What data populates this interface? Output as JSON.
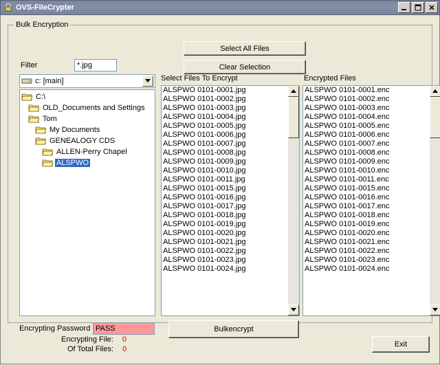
{
  "window": {
    "title": "OVS-FileCrypter"
  },
  "group_title": "Bulk Encryption",
  "buttons": {
    "select_all": "Select All Files",
    "clear_selection": "Clear Selection",
    "bulk_encrypt": "Bulkencrypt",
    "exit": "Exit"
  },
  "filter": {
    "label": "Filter",
    "value": "*.jpg"
  },
  "drive": {
    "text": "c: [main]"
  },
  "tree": [
    {
      "indent": 0,
      "label": "C:\\"
    },
    {
      "indent": 1,
      "label": "OLD_Documents and Settings"
    },
    {
      "indent": 1,
      "label": "Tom"
    },
    {
      "indent": 2,
      "label": "My Documents"
    },
    {
      "indent": 2,
      "label": "GENEALOGY CDS"
    },
    {
      "indent": 3,
      "label": "ALLEN-Perry Chapel"
    },
    {
      "indent": 3,
      "label": "ALSPWO",
      "selected": true
    }
  ],
  "list_labels": {
    "left": "Select Files To Encrypt",
    "right": "Encrypted Files"
  },
  "files_to_encrypt": [
    "ALSPWO 0101-0001.jpg",
    "ALSPWO 0101-0002.jpg",
    "ALSPWO 0101-0003.jpg",
    "ALSPWO 0101-0004.jpg",
    "ALSPWO 0101-0005.jpg",
    "ALSPWO 0101-0006.jpg",
    "ALSPWO 0101-0007.jpg",
    "ALSPWO 0101-0008.jpg",
    "ALSPWO 0101-0009.jpg",
    "ALSPWO 0101-0010.jpg",
    "ALSPWO 0101-0011.jpg",
    "ALSPWO 0101-0015.jpg",
    "ALSPWO 0101-0016.jpg",
    "ALSPWO 0101-0017.jpg",
    "ALSPWO 0101-0018.jpg",
    "ALSPWO 0101-0019.jpg",
    "ALSPWO 0101-0020.jpg",
    "ALSPWO 0101-0021.jpg",
    "ALSPWO 0101-0022.jpg",
    "ALSPWO 0101-0023.jpg",
    "ALSPWO 0101-0024.jpg"
  ],
  "files_encrypted": [
    "ALSPWO 0101-0001.enc",
    "ALSPWO 0101-0002.enc",
    "ALSPWO 0101-0003.enc",
    "ALSPWO 0101-0004.enc",
    "ALSPWO 0101-0005.enc",
    "ALSPWO 0101-0006.enc",
    "ALSPWO 0101-0007.enc",
    "ALSPWO 0101-0008.enc",
    "ALSPWO 0101-0009.enc",
    "ALSPWO 0101-0010.enc",
    "ALSPWO 0101-0011.enc",
    "ALSPWO 0101-0015.enc",
    "ALSPWO 0101-0016.enc",
    "ALSPWO 0101-0017.enc",
    "ALSPWO 0101-0018.enc",
    "ALSPWO 0101-0019.enc",
    "ALSPWO 0101-0020.enc",
    "ALSPWO 0101-0021.enc",
    "ALSPWO 0101-0022.enc",
    "ALSPWO 0101-0023.enc",
    "ALSPWO 0101-0024.enc"
  ],
  "password": {
    "label": "Encrypting Password",
    "value": "PASS"
  },
  "stats": {
    "encrypting_label": "Encrypting File:",
    "encrypting_value": "0",
    "total_label": "Of Total Files:",
    "total_value": "0"
  }
}
